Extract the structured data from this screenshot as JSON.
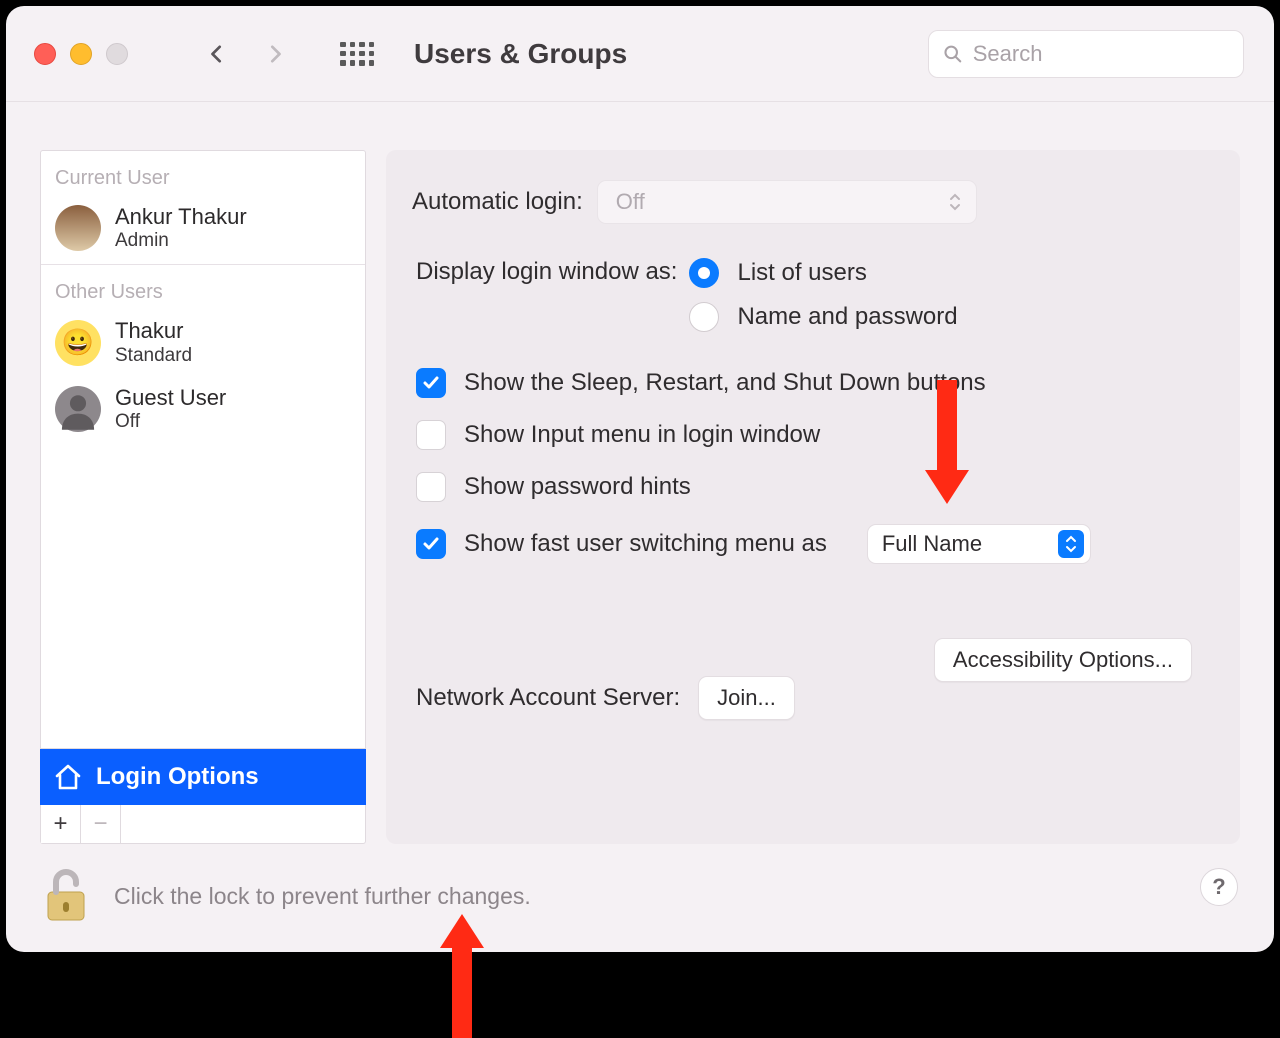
{
  "toolbar": {
    "title": "Users & Groups",
    "search_placeholder": "Search"
  },
  "sidebar": {
    "current_user_label": "Current User",
    "other_users_label": "Other Users",
    "current_user": {
      "name": "Ankur Thakur",
      "role": "Admin"
    },
    "other_users": [
      {
        "name": "Thakur",
        "role": "Standard",
        "icon": "smiley"
      },
      {
        "name": "Guest User",
        "role": "Off",
        "icon": "silhouette"
      }
    ],
    "login_options_label": "Login Options",
    "add_label": "+",
    "remove_label": "−"
  },
  "panel": {
    "auto_login_label": "Automatic login:",
    "auto_login_value": "Off",
    "display_window_label": "Display login window as:",
    "radio_list": "List of users",
    "radio_namepw": "Name and password",
    "cb_sleep": "Show the Sleep, Restart, and Shut Down buttons",
    "cb_input": "Show Input menu in login window",
    "cb_hints": "Show password hints",
    "cb_fus": "Show fast user switching menu as",
    "fus_value": "Full Name",
    "access_btn": "Accessibility Options...",
    "network_label": "Network Account Server:",
    "join_btn": "Join..."
  },
  "footer": {
    "lock_text": "Click the lock to prevent further changes.",
    "help": "?"
  }
}
